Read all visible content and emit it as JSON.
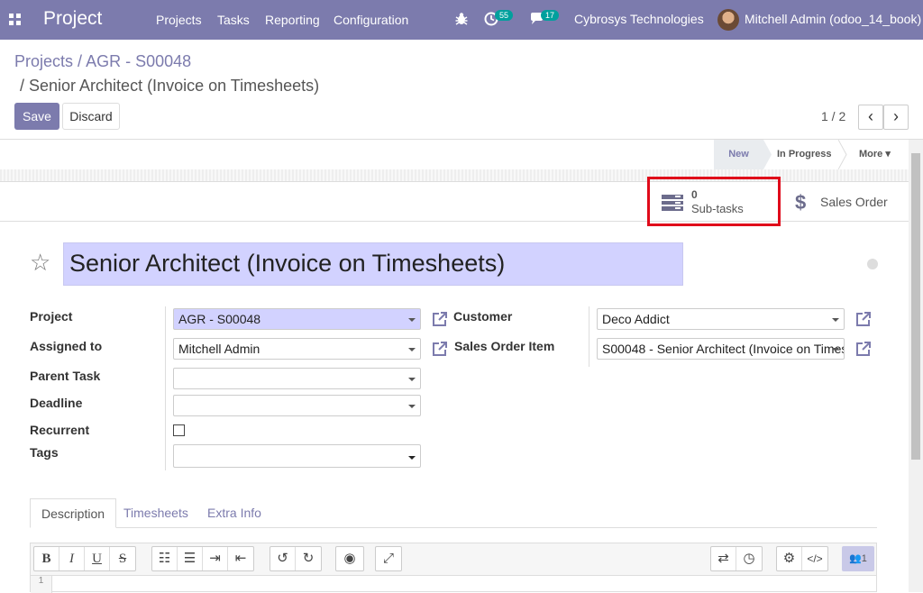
{
  "navbar": {
    "brand": "Project",
    "menu": [
      "Projects",
      "Tasks",
      "Reporting",
      "Configuration"
    ],
    "activity_count": "55",
    "messages_count": "17",
    "company": "Cybrosys Technologies",
    "user": "Mitchell Admin (odoo_14_book)"
  },
  "breadcrumb": {
    "root": "Projects",
    "sep": "/",
    "parent": "AGR - S00048",
    "current": "/ Senior Architect (Invoice on Timesheets)"
  },
  "buttons": {
    "save": "Save",
    "discard": "Discard"
  },
  "pager": {
    "value": "1 / 2"
  },
  "stages": {
    "new": "New",
    "in_progress": "In Progress",
    "more": "More ▾"
  },
  "smart": {
    "subtasks_count": "0",
    "subtasks_label": "Sub-tasks",
    "sales_order": "Sales Order"
  },
  "task": {
    "name": "Senior Architect (Invoice on Timesheets)"
  },
  "fields": {
    "project_label": "Project",
    "project_value": "AGR - S00048",
    "assigned_label": "Assigned to",
    "assigned_value": "Mitchell Admin",
    "parent_label": "Parent Task",
    "parent_value": "",
    "deadline_label": "Deadline",
    "deadline_value": "",
    "recurrent_label": "Recurrent",
    "tags_label": "Tags",
    "customer_label": "Customer",
    "customer_value": "Deco Addict",
    "so_item_label": "Sales Order Item",
    "so_item_value": "S00048 - Senior Architect (Invoice on Times"
  },
  "tabs": [
    "Description",
    "Timesheets",
    "Extra Info"
  ],
  "editor": {
    "line": "1",
    "followers": "1"
  },
  "colors": {
    "brand": "#7c7bad",
    "required": "#d2d2ff",
    "highlight": "#e00a1a"
  }
}
